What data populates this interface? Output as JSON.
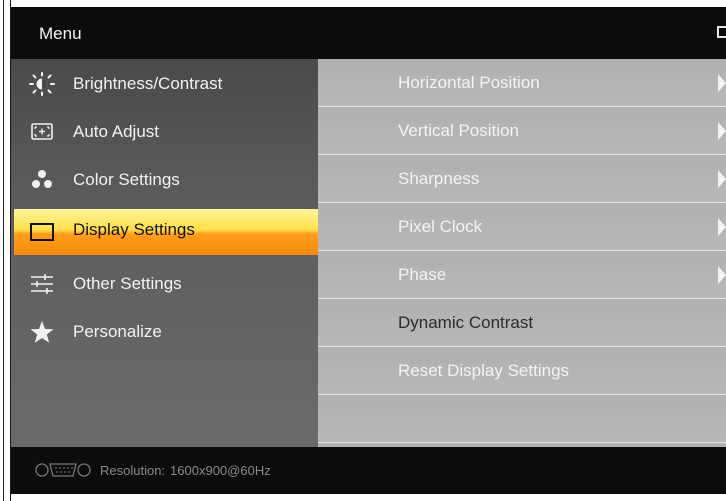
{
  "menu": {
    "title": "Menu"
  },
  "sidebar": {
    "items": [
      {
        "label": "Brightness/Contrast",
        "icon": "brightness-icon"
      },
      {
        "label": "Auto Adjust",
        "icon": "auto-adjust-icon"
      },
      {
        "label": "Color Settings",
        "icon": "color-settings-icon"
      },
      {
        "label": "Display Settings",
        "icon": "display-icon",
        "selected": true
      },
      {
        "label": "Other Settings",
        "icon": "sliders-icon"
      },
      {
        "label": "Personalize",
        "icon": "star-icon"
      }
    ]
  },
  "content": {
    "rows": [
      {
        "label": "Horizontal Position",
        "submenu": true
      },
      {
        "label": "Vertical Position",
        "submenu": true
      },
      {
        "label": "Sharpness",
        "submenu": true
      },
      {
        "label": "Pixel Clock",
        "submenu": true
      },
      {
        "label": "Phase",
        "submenu": true
      },
      {
        "label": "Dynamic Contrast",
        "submenu": false,
        "inactive": true
      },
      {
        "label": "Reset Display Settings",
        "submenu": false
      }
    ]
  },
  "footer": {
    "resolution_label": "Resolution:",
    "resolution_value": "1600x900@60Hz",
    "connector_icon": "vga-connector-icon"
  },
  "colors": {
    "selected_highlight_top": "#fff59a",
    "selected_highlight_bottom": "#f58a0c",
    "panel_gray": "#b3b3b3",
    "background": "#0b0b0b"
  }
}
